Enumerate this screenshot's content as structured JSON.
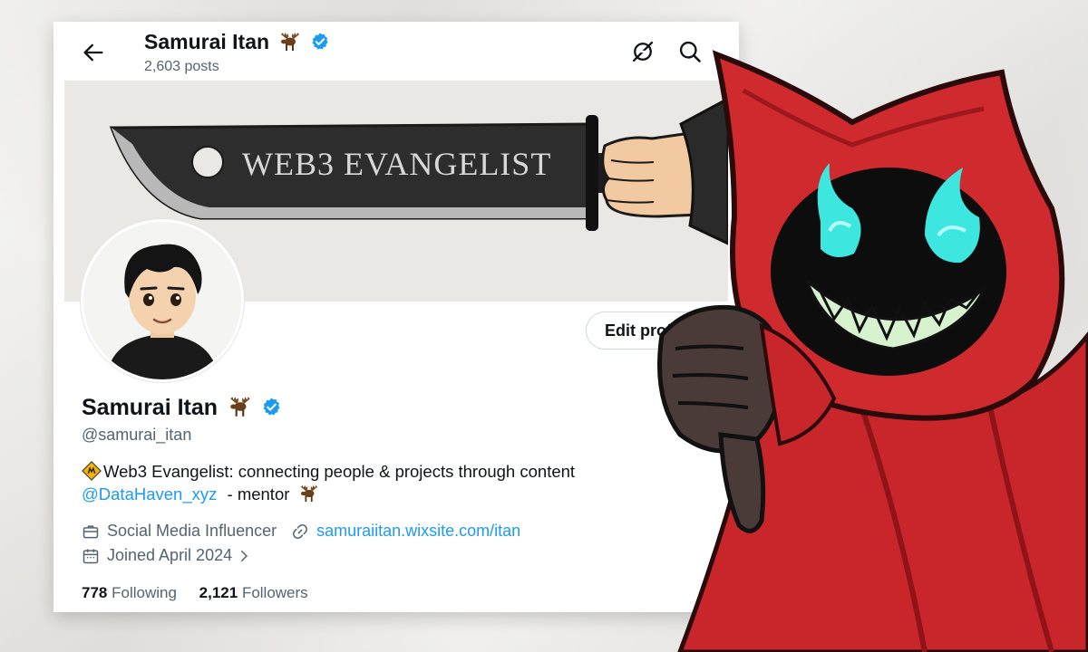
{
  "header": {
    "name": "Samurai Itan",
    "posts": "2,603 posts"
  },
  "banner": {
    "blade_text": "WEB3 EVANGELIST"
  },
  "profile": {
    "name": "Samurai Itan",
    "handle": "@samurai_itan",
    "edit_label": "Edit profile",
    "bio_line1": "Web3 Evangelist: connecting people & projects through content",
    "bio_mention": "@DataHaven_xyz",
    "bio_line2_rest": " - mentor",
    "category": "Social Media Influencer",
    "website": "samuraiitan.wixsite.com/itan",
    "joined": "Joined April 2024",
    "following_count": "778",
    "following_label": "Following",
    "followers_count": "2,121",
    "followers_label": "Followers"
  },
  "icons": {
    "back": "arrow-left-icon",
    "grok": "grok-icon",
    "search": "search-icon",
    "verified": "verified-badge-icon",
    "moose": "moose-emoji",
    "briefcase": "briefcase-icon",
    "link": "link-icon",
    "calendar": "calendar-icon",
    "chevron": "chevron-right-icon"
  },
  "colors": {
    "accent": "#1d9bf0",
    "text": "#0f1419",
    "muted": "#536471",
    "hood_red": "#c8262a",
    "eye_cyan": "#3ee6e0"
  }
}
